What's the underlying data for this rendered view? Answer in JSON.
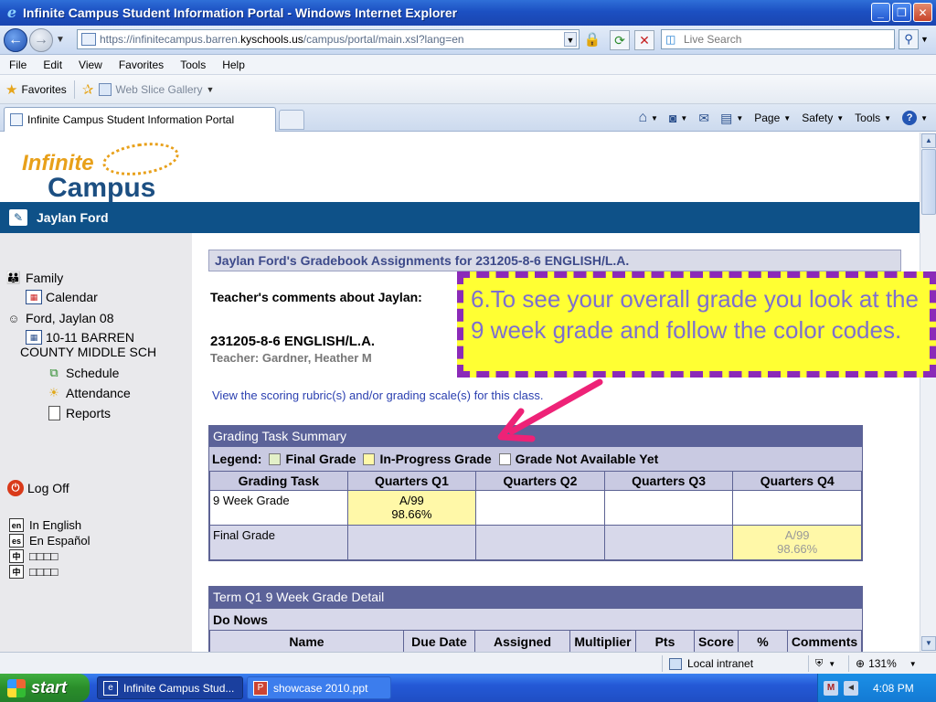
{
  "window": {
    "title": "Infinite Campus Student Information Portal - Windows Internet Explorer",
    "minimize": "_",
    "restore": "❐",
    "close": "✕"
  },
  "address": {
    "url_prefix": "https://infinitecampus.barren.",
    "url_host": "kyschools.us",
    "url_suffix": "/campus/portal/main.xsl?lang=en",
    "search_placeholder": "Live Search"
  },
  "menu": [
    "File",
    "Edit",
    "View",
    "Favorites",
    "Tools",
    "Help"
  ],
  "favorites": {
    "label": "Favorites",
    "web_slice": "Web Slice Gallery"
  },
  "tab": {
    "title": "Infinite Campus Student Information Portal"
  },
  "command_bar": {
    "page": "Page",
    "safety": "Safety",
    "tools": "Tools"
  },
  "logo": {
    "line1": "Infinite",
    "line2": "Campus"
  },
  "user": {
    "name": "Jaylan Ford"
  },
  "sidebar": {
    "family": "Family",
    "calendar": "Calendar",
    "student": "Ford, Jaylan 08",
    "school_line1": "10-11 BARREN",
    "school_line2": "COUNTY MIDDLE SCH",
    "schedule": "Schedule",
    "attendance": "Attendance",
    "reports": "Reports",
    "logoff": "Log Off",
    "languages": [
      {
        "code": "en",
        "label": "In English"
      },
      {
        "code": "es",
        "label": "En Español"
      },
      {
        "code": "中",
        "label": "□□□□"
      },
      {
        "code": "中",
        "label": "□□□□"
      }
    ]
  },
  "gradebook": {
    "header": "Jaylan Ford's Gradebook Assignments for 231205-8-6 ENGLISH/L.A.",
    "teacher_comments": "Teacher's comments about Jaylan:",
    "course": "231205-8-6 ENGLISH/L.A.",
    "teacher": "Teacher: Gardner, Heather M",
    "rubric_link": "View the scoring rubric(s) and/or grading scale(s) for this class."
  },
  "summary": {
    "title": "Grading Task Summary",
    "legend_label": "Legend:",
    "legend_final": "Final Grade",
    "legend_progress": "In-Progress Grade",
    "legend_na": "Grade Not Available Yet",
    "columns": [
      "Grading Task",
      "Quarters Q1",
      "Quarters Q2",
      "Quarters Q3",
      "Quarters Q4"
    ],
    "rows": [
      {
        "task": "9 Week Grade",
        "q1_grade": "A/99",
        "q1_pct": "98.66%"
      },
      {
        "task": "Final Grade",
        "q4_grade": "A/99",
        "q4_pct": "98.66%"
      }
    ]
  },
  "detail": {
    "title": "Term Q1 9 Week Grade Detail",
    "subtitle": "Do Nows",
    "columns": [
      "Name",
      "Due Date",
      "Assigned",
      "Multiplier",
      "Pts",
      "Score",
      "%",
      "Comments"
    ]
  },
  "callout": {
    "text": "6.To see your overall grade you look at the 9 week grade and follow the color codes."
  },
  "status": {
    "zone": "Local intranet",
    "zoom": "131%"
  },
  "taskbar": {
    "start": "start",
    "item1": "Infinite Campus Stud...",
    "item2": "showcase 2010.ppt",
    "clock": "4:08 PM"
  },
  "colors": {
    "user_bar": "#0e5188",
    "summary_header": "#5b6299",
    "in_progress": "#fff8a8",
    "callout_bg": "#ffff33",
    "callout_border": "#8b2ab8",
    "arrow": "#ee2277"
  }
}
